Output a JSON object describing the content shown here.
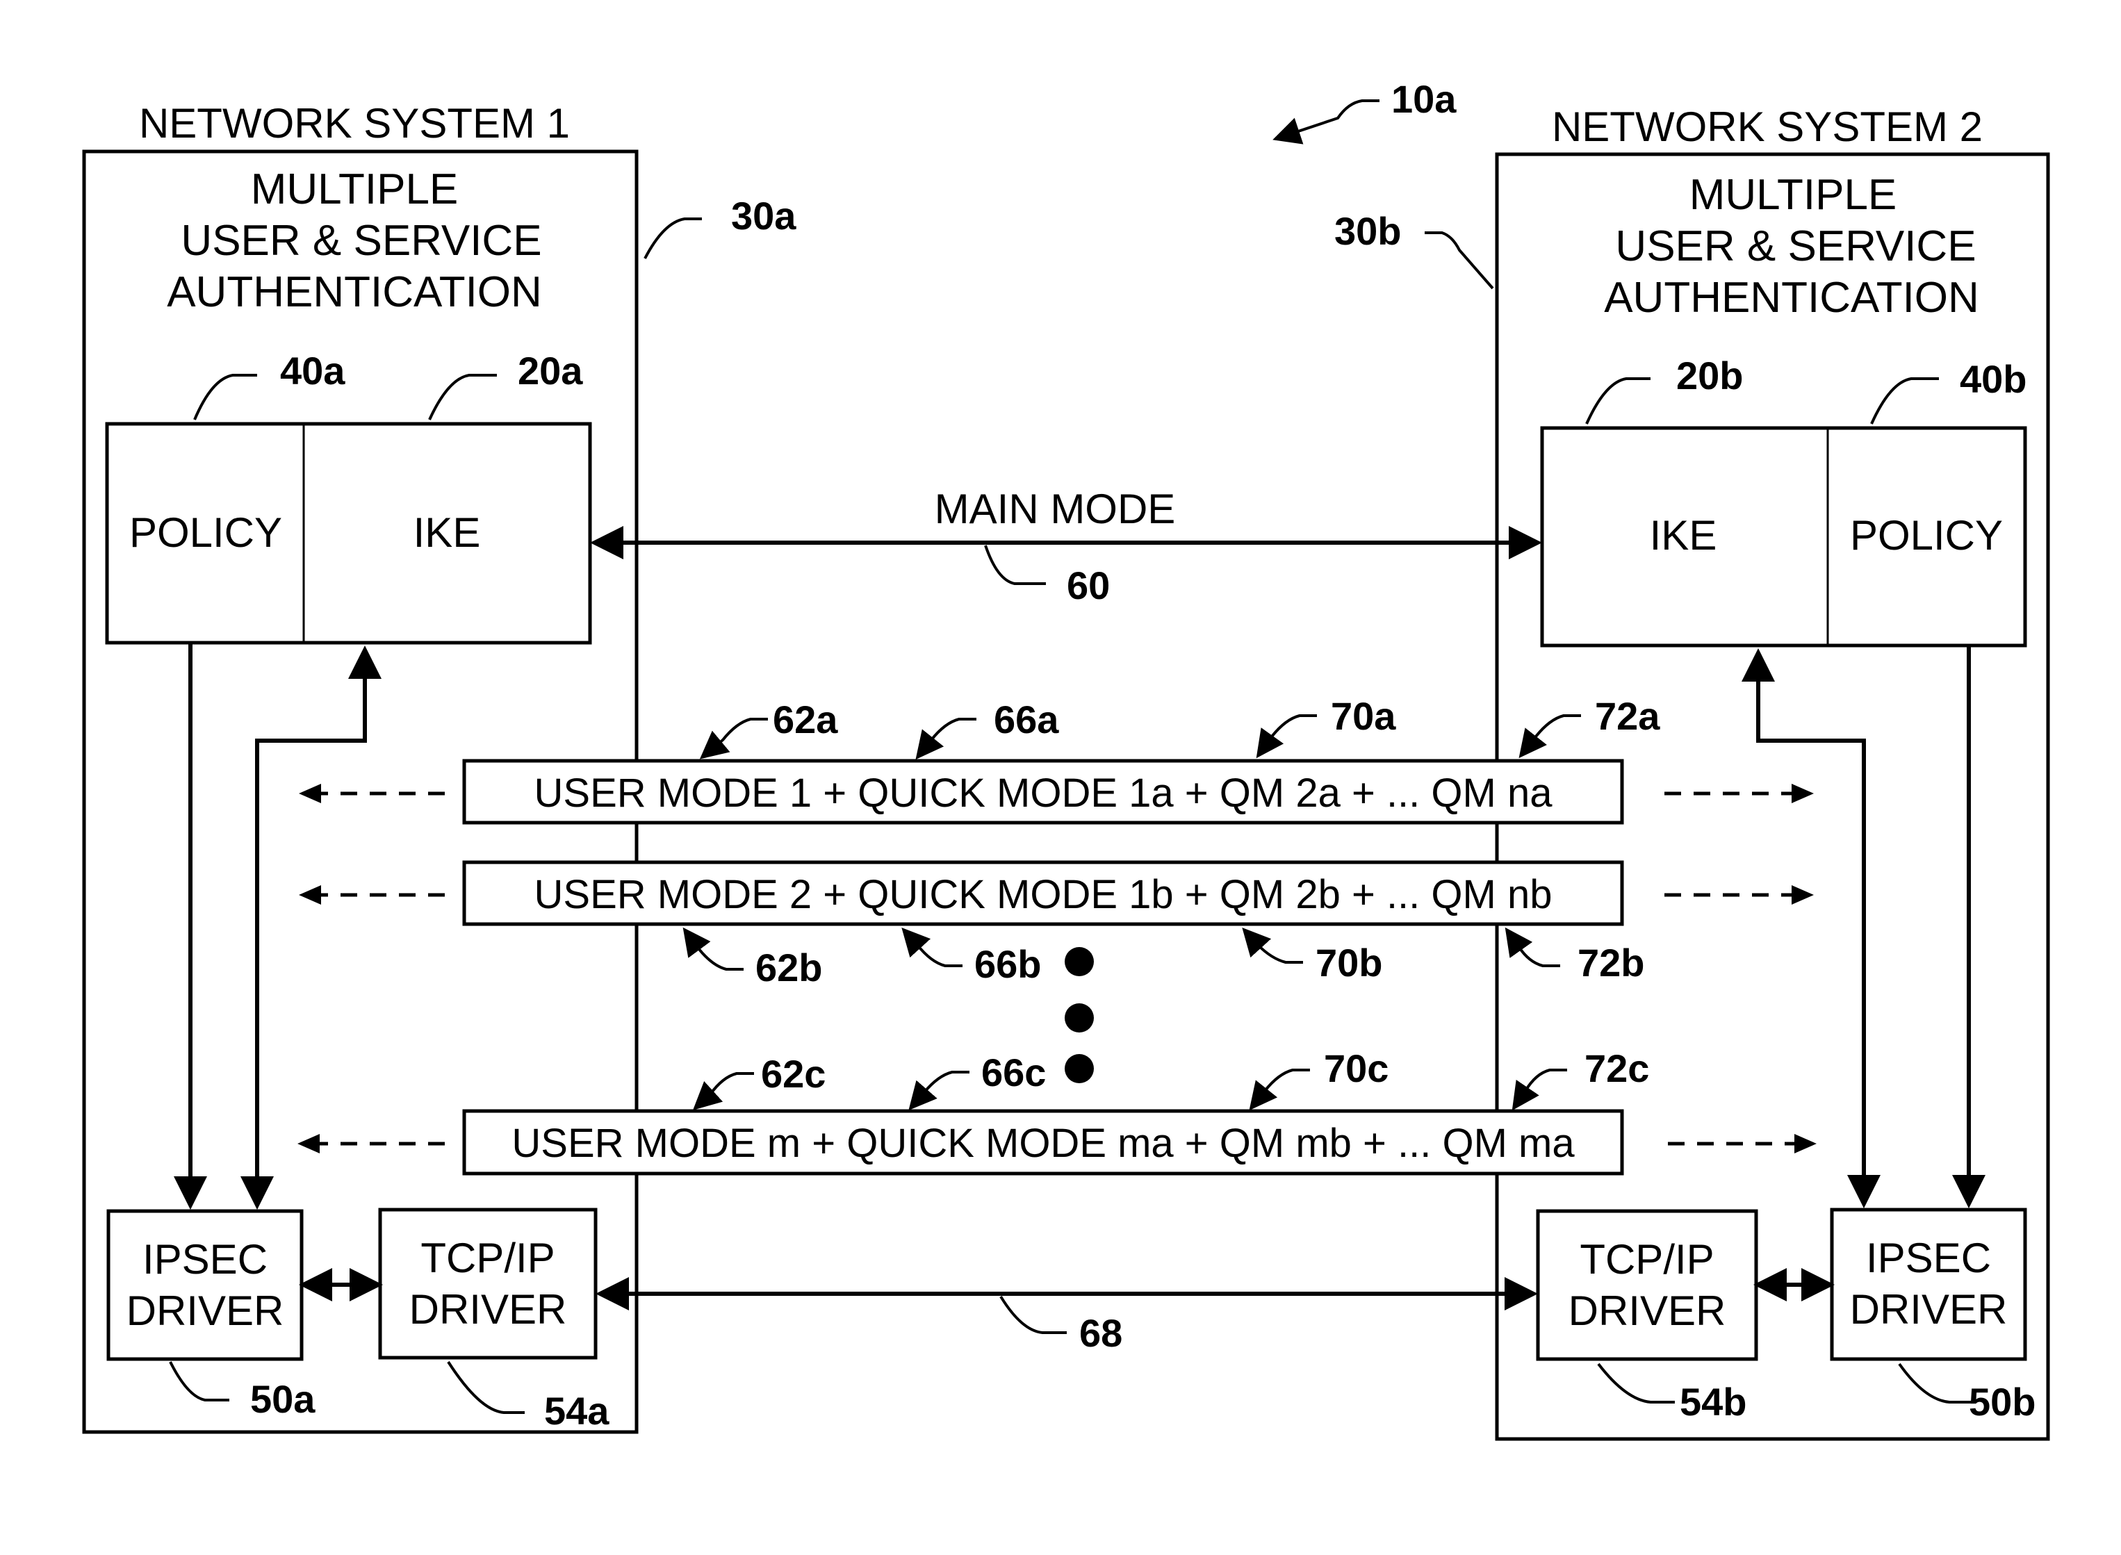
{
  "figure_ref": "10a",
  "system1": {
    "title": "NETWORK SYSTEM 1",
    "heading_lines": [
      "MULTIPLE",
      "USER & SERVICE",
      "AUTHENTICATION"
    ],
    "ref": "30a",
    "policy": {
      "label": "POLICY",
      "ref": "40a"
    },
    "ike": {
      "label": "IKE",
      "ref": "20a"
    },
    "ipsec_driver": {
      "lines": [
        "IPSEC",
        "DRIVER"
      ],
      "ref": "50a"
    },
    "tcpip_driver": {
      "lines": [
        "TCP/IP",
        "DRIVER"
      ],
      "ref": "54a"
    }
  },
  "system2": {
    "title": "NETWORK SYSTEM 2",
    "heading_lines": [
      "MULTIPLE",
      "USER & SERVICE",
      "AUTHENTICATION"
    ],
    "ref": "30b",
    "policy": {
      "label": "POLICY",
      "ref": "40b"
    },
    "ike": {
      "label": "IKE",
      "ref": "20b"
    },
    "ipsec_driver": {
      "lines": [
        "IPSEC",
        "DRIVER"
      ],
      "ref": "50b"
    },
    "tcpip_driver": {
      "lines": [
        "TCP/IP",
        "DRIVER"
      ],
      "ref": "54b"
    }
  },
  "main_mode": {
    "label": "MAIN MODE",
    "ref": "60"
  },
  "transport_link": {
    "ref": "68"
  },
  "mode_bars": [
    {
      "text": "USER MODE 1 + QUICK MODE 1a + QM 2a + ... QM na",
      "refs": [
        "62a",
        "66a",
        "70a",
        "72a"
      ]
    },
    {
      "text": "USER MODE 2 + QUICK MODE 1b + QM 2b + ... QM nb",
      "refs": [
        "62b",
        "66b",
        "70b",
        "72b"
      ]
    },
    {
      "text": "USER MODE m + QUICK MODE ma + QM mb + ... QM ma",
      "refs": [
        "62c",
        "66c",
        "70c",
        "72c"
      ]
    }
  ],
  "ellipsis_icon": "vertical-dots"
}
